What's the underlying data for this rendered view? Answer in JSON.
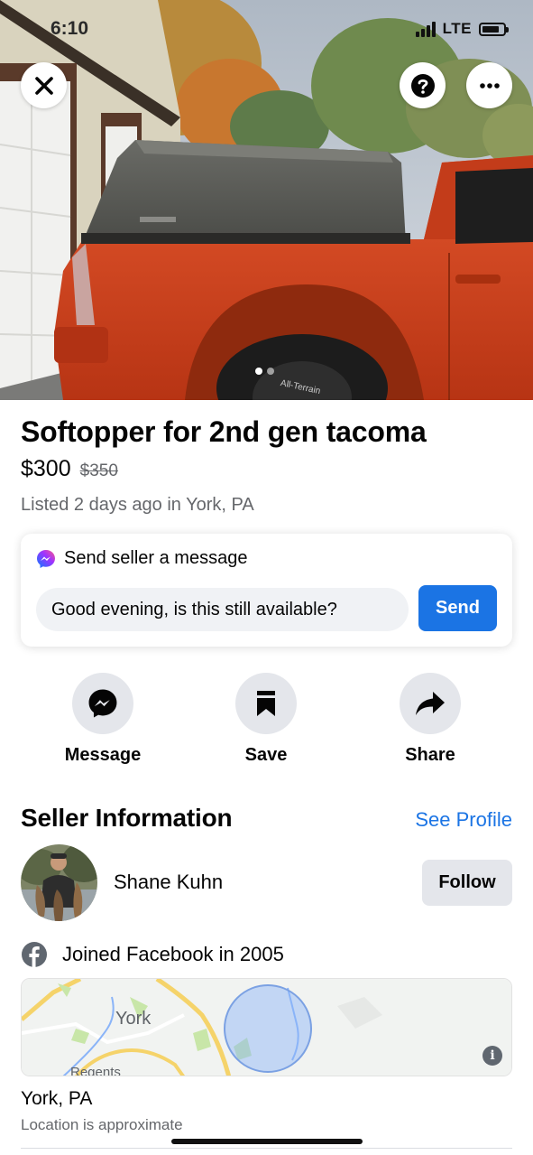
{
  "status_bar": {
    "time": "6:10",
    "network": "LTE"
  },
  "photo": {
    "current_index": 1,
    "total": 2
  },
  "listing": {
    "title": "Softopper for 2nd gen tacoma",
    "price": "$300",
    "original_price": "$350",
    "listed": "Listed 2 days ago in York, PA"
  },
  "message_box": {
    "heading": "Send seller a message",
    "input_value": "Good evening, is this still available?",
    "send_label": "Send"
  },
  "actions": [
    {
      "label": "Message",
      "icon": "messenger-icon"
    },
    {
      "label": "Save",
      "icon": "bookmark-icon"
    },
    {
      "label": "Share",
      "icon": "share-arrow-icon"
    }
  ],
  "seller": {
    "section_title": "Seller Information",
    "see_profile_label": "See Profile",
    "name": "Shane Kuhn",
    "follow_label": "Follow",
    "joined": "Joined Facebook in 2005"
  },
  "map": {
    "labels": [
      "York",
      "Regents"
    ]
  },
  "location": {
    "name": "York, PA",
    "note": "Location is approximate"
  },
  "colors": {
    "accent": "#1b74e4",
    "truck": "#d2421f",
    "secondary_text": "#65676b"
  }
}
